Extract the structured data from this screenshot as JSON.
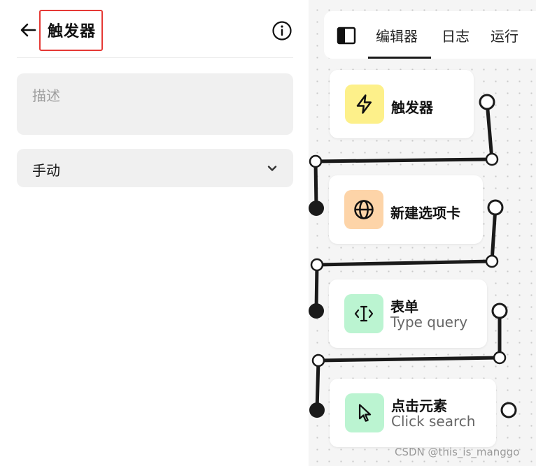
{
  "header": {
    "title": "触发器"
  },
  "form": {
    "description_placeholder": "描述",
    "trigger_type": "手动"
  },
  "toolbar": {
    "tabs": [
      {
        "label": "编辑器",
        "active": true
      },
      {
        "label": "日志",
        "active": false
      },
      {
        "label": "运行",
        "active": false
      }
    ]
  },
  "nodes": [
    {
      "title": "触发器",
      "subtitle": "",
      "icon": "lightning-icon",
      "color": "#fdf08a"
    },
    {
      "title": "新建选项卡",
      "subtitle": "",
      "icon": "globe-icon",
      "color": "#fdd4a8"
    },
    {
      "title": "表单",
      "subtitle": "Type query",
      "icon": "text-cursor-icon",
      "color": "#bbf4d1"
    },
    {
      "title": "点击元素",
      "subtitle": "Click search",
      "icon": "cursor-pointer-icon",
      "color": "#bbf4d1"
    }
  ],
  "watermark": "CSDN @this_is_manggo",
  "colors": {
    "title_highlight_border": "#e53935",
    "canvas_bg": "#f5f5f5",
    "field_bg": "#f0f0f0"
  }
}
